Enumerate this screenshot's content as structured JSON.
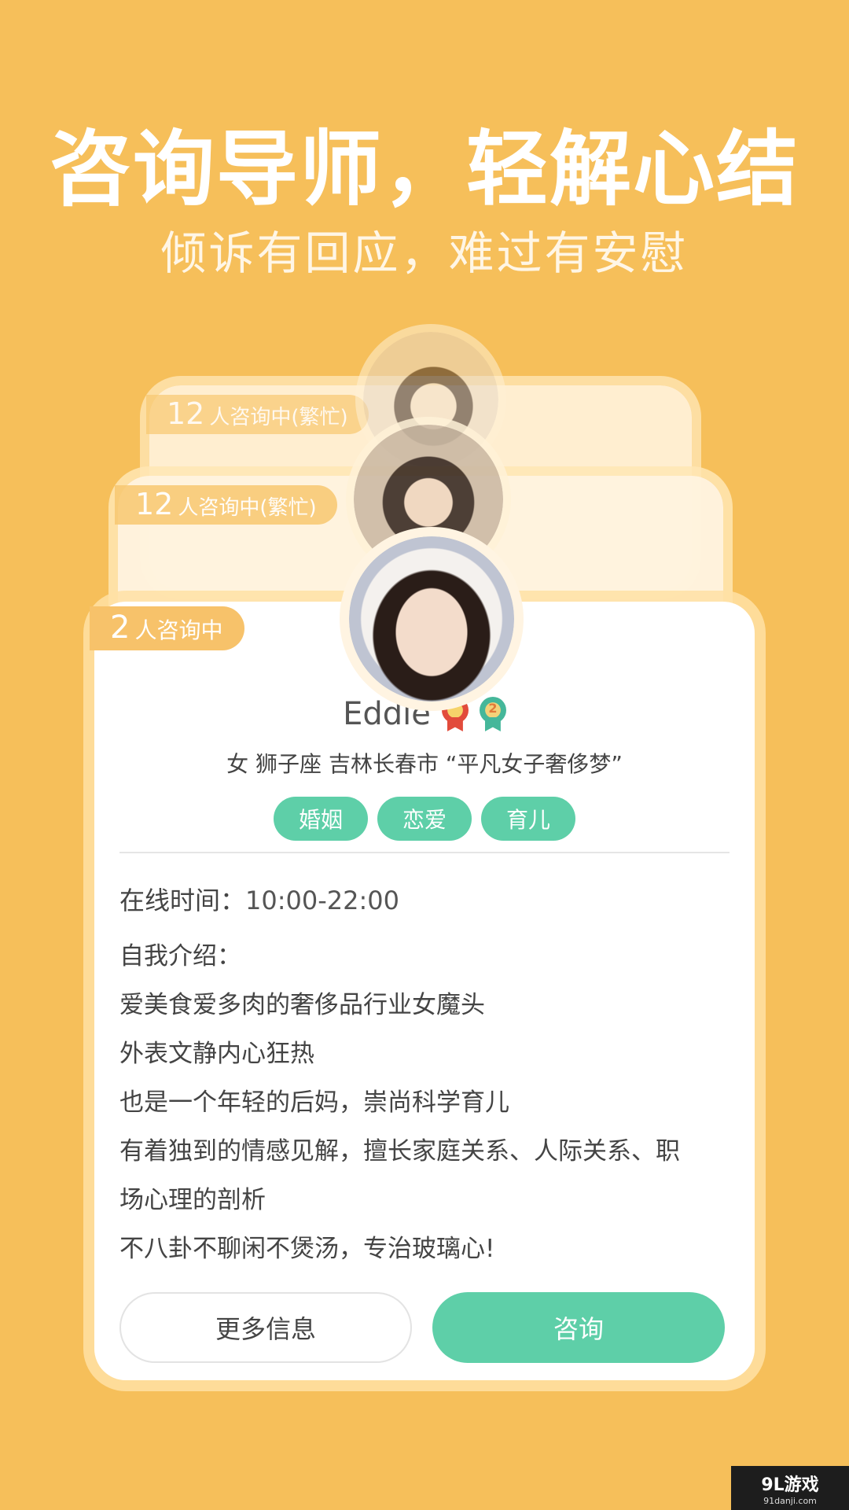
{
  "header": {
    "title": "咨询导师，轻解心结",
    "subtitle": "倾诉有回应，难过有安慰"
  },
  "back_cards": [
    {
      "count": "12",
      "status": "人咨询中(繁忙)"
    },
    {
      "count": "12",
      "status": "人咨询中(繁忙)"
    }
  ],
  "profile": {
    "count": "2",
    "status": "人咨询中",
    "name": "Eddie",
    "medals": [
      {
        "icon": "medal-red-icon",
        "color": "#E24B3B",
        "label": ""
      },
      {
        "icon": "medal-green-icon",
        "color": "#45B79A",
        "label": "2"
      }
    ],
    "info": "女 狮子座 吉林长春市 “平凡女子奢侈梦”",
    "tags": [
      "婚姻",
      "恋爱",
      "育儿"
    ],
    "online_label": "在线时间：",
    "online_time": "10:00-22:00",
    "intro_label": "自我介绍：",
    "intro_lines": [
      "爱美食爱多肉的奢侈品行业女魔头",
      "外表文静内心狂热",
      "也是一个年轻的后妈，崇尚科学育儿",
      "有着独到的情感见解，擅长家庭关系、人际关系、职",
      "场心理的剖析",
      "不八卦不聊闲不煲汤，专治玻璃心!"
    ]
  },
  "buttons": {
    "more_label": "更多信息",
    "consult_label": "咨询"
  },
  "watermark": {
    "main": "9L游戏",
    "sub": "91danji.com"
  },
  "colors": {
    "background": "#F6BF5A",
    "accent_green": "#5ECFA8",
    "tag_orange": "#F7C26A"
  }
}
